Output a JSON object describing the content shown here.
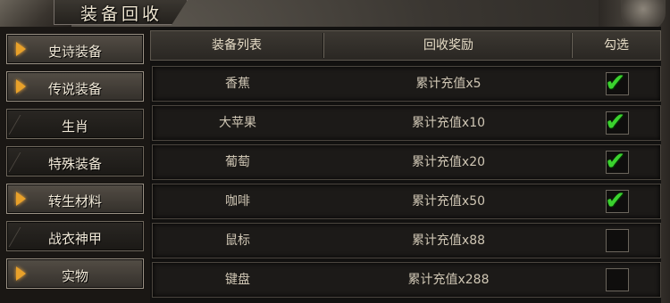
{
  "window": {
    "title": "装备回收"
  },
  "menu": [
    {
      "label": "史诗装备",
      "has_arrow": true,
      "active": true
    },
    {
      "label": "传说装备",
      "has_arrow": true,
      "active": true
    },
    {
      "label": "生肖",
      "has_arrow": false,
      "active": false
    },
    {
      "label": "特殊装备",
      "has_arrow": false,
      "active": false
    },
    {
      "label": "转生材料",
      "has_arrow": true,
      "active": true
    },
    {
      "label": "战衣神甲",
      "has_arrow": false,
      "active": false
    },
    {
      "label": "实物",
      "has_arrow": true,
      "active": true
    }
  ],
  "table": {
    "headers": {
      "equip": "装备列表",
      "reward": "回收奖励",
      "select": "勾选"
    },
    "rows": [
      {
        "name": "香蕉",
        "reward": "累计充值x5",
        "checked": true
      },
      {
        "name": "大苹果",
        "reward": "累计充值x10",
        "checked": true
      },
      {
        "name": "葡萄",
        "reward": "累计充值x20",
        "checked": true
      },
      {
        "name": "咖啡",
        "reward": "累计充值x50",
        "checked": true
      },
      {
        "name": "鼠标",
        "reward": "累计充值x88",
        "checked": false
      },
      {
        "name": "键盘",
        "reward": "累计充值x288",
        "checked": false
      }
    ]
  },
  "colors": {
    "accent_arrow": "#e8a12a",
    "check_green": "#3ad22e"
  }
}
